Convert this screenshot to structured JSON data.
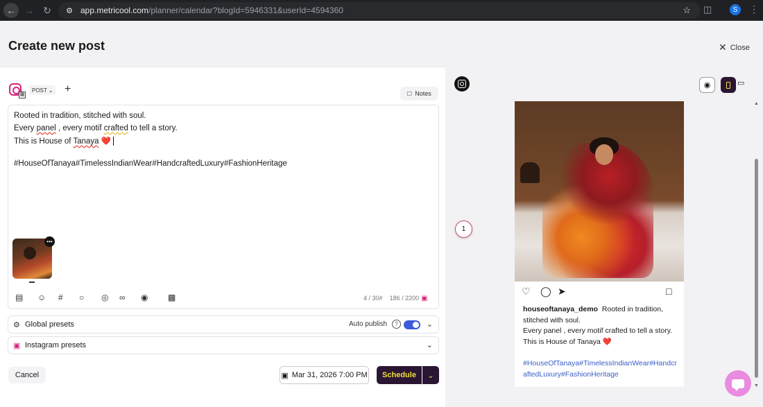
{
  "browser": {
    "url_domain": "app.metricool.com",
    "url_path": "/planner/calendar?blogId=5946331&userId=4594360",
    "profile_initial": "S"
  },
  "header": {
    "title": "Create new post",
    "close_label": "Close"
  },
  "editor": {
    "post_type": "POST",
    "notes_label": "Notes",
    "caption": {
      "line1": "Rooted in tradition, stitched with soul.",
      "line2_a": "Every ",
      "line2_b": "panel",
      "line2_c": " , every motif ",
      "line2_d": "crafted",
      "line2_e": " to tell a story.",
      "line3_a": "This is House of ",
      "line3_b": "Tanaya",
      "line3_heart": "❤️",
      "hashtags": "#HouseOfTanaya#TimelessIndianWear#HandcraftedLuxury#FashionHeritage"
    },
    "hashtag_count": "4 / 30",
    "char_count": "186 / 2200"
  },
  "presets": {
    "global_label": "Global presets",
    "auto_publish_label": "Auto publish",
    "auto_publish_on": true,
    "instagram_label": "Instagram presets"
  },
  "footer": {
    "cancel_label": "Cancel",
    "date_label": "Mar 31, 2026 7:00 PM",
    "schedule_label": "Schedule"
  },
  "preview": {
    "step_number": "1",
    "username": "houseoftanaya_demo",
    "caption_first": "Rooted in tradition, stitched with soul.",
    "caption_second": "Every panel , every motif crafted to tell a story.",
    "caption_third": "This is House of Tanaya",
    "caption_heart": "❤️",
    "hashtags": "#HouseOfTanaya#TimelessIndianWear#HandcraftedLuxury#FashionHeritage"
  },
  "colors": {
    "brand_dark": "#2a1633",
    "brand_yellow": "#f3df3d",
    "instagram_pink": "#d6247c",
    "toggle_blue": "#3b5bdb",
    "hashtag_blue": "#3b5ec5",
    "chat_pink": "#e98be0"
  }
}
